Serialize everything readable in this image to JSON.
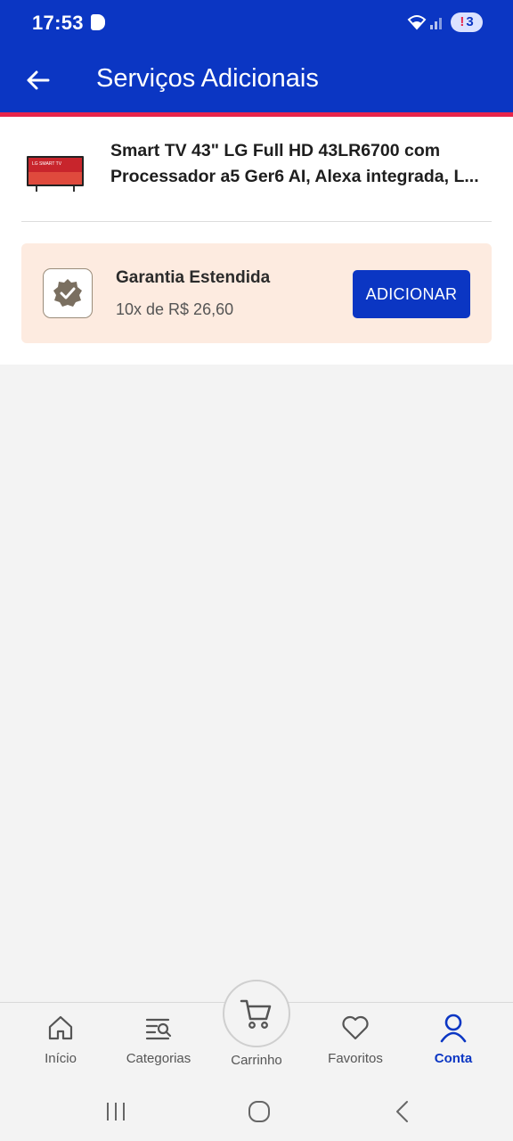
{
  "status_bar": {
    "time": "17:53",
    "battery": "3"
  },
  "header": {
    "title": "Serviços Adicionais"
  },
  "product": {
    "thumb_text": "LG SMART TV",
    "name_line1": "Smart TV 43\" LG Full HD 43LR6700 com",
    "name_line2": "Processador a5 Ger6 AI, Alexa integrada, L..."
  },
  "service": {
    "title": "Garantia Estendida",
    "price": "10x de R$ 26,60",
    "button_label": "ADICIONAR"
  },
  "bottom_nav": {
    "items": [
      {
        "label": "Início",
        "icon": "home-icon"
      },
      {
        "label": "Categorias",
        "icon": "categories-icon"
      },
      {
        "label": "Carrinho",
        "icon": "cart-icon"
      },
      {
        "label": "Favoritos",
        "icon": "heart-icon"
      },
      {
        "label": "Conta",
        "icon": "user-icon",
        "active": true
      }
    ]
  },
  "colors": {
    "brand": "#0b36c3",
    "accent": "#e8254b",
    "card_bg": "#fdebe0"
  }
}
